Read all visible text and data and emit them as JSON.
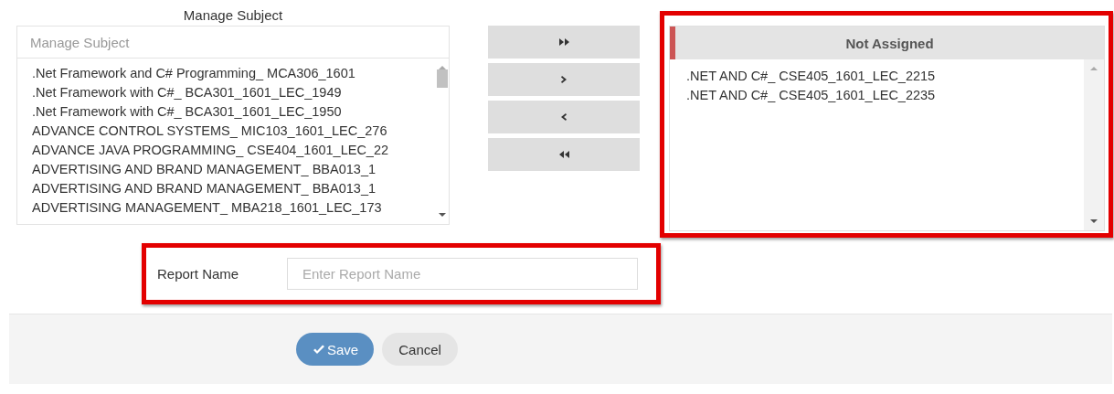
{
  "manage_subject": {
    "title": "Manage Subject",
    "search": {
      "placeholder": "Manage Subject"
    },
    "items": [
      {
        "label": ".Net Framework and C# Programming_ MCA306_1601",
        "selected": false
      },
      {
        "label": ".Net Framework with C#_ BCA301_1601_LEC_1949",
        "selected": false
      },
      {
        "label": ".Net Framework with C#_ BCA301_1601_LEC_1950",
        "selected": false
      },
      {
        "label": "ADVANCE CONTROL SYSTEMS_ MIC103_1601_LEC_276",
        "selected": false
      },
      {
        "label": "ADVANCE JAVA PROGRAMMING_ CSE404_1601_LEC_22",
        "selected": false
      },
      {
        "label": "ADVERTISING AND BRAND MANAGEMENT_ BBA013_1",
        "selected": false
      },
      {
        "label": "ADVERTISING AND BRAND MANAGEMENT_ BBA013_1",
        "selected": false
      },
      {
        "label": "ADVERTISING MANAGEMENT_ MBA218_1601_LEC_173",
        "selected": false
      }
    ]
  },
  "move_buttons": [
    {
      "kind": "all-right"
    },
    {
      "kind": "right"
    },
    {
      "kind": "left"
    },
    {
      "kind": "all-left"
    }
  ],
  "not_assigned": {
    "title": "Not Assigned",
    "items": [
      {
        "label": ".NET AND C#_ CSE405_1601_LEC_2215",
        "selected": false
      },
      {
        "label": ".NET AND C#_ CSE405_1601_LEC_2235",
        "selected": false
      }
    ]
  },
  "report_name": {
    "label": "Report Name",
    "placeholder": "Enter Report Name"
  },
  "buttons": [
    {
      "kind": "save",
      "label": "Save"
    },
    {
      "kind": "cancel",
      "label": "Cancel"
    }
  ]
}
